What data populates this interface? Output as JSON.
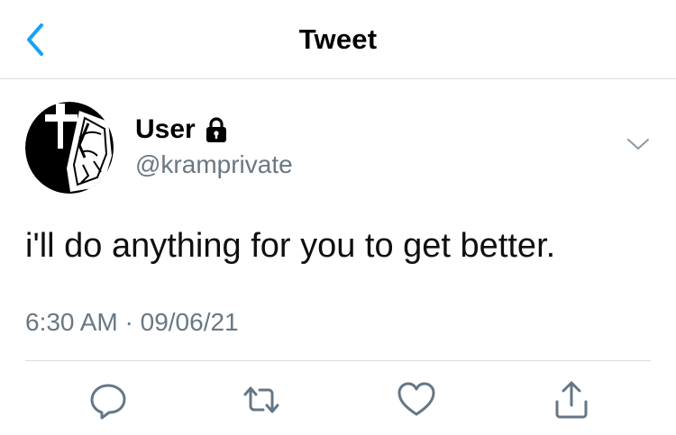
{
  "nav": {
    "title": "Tweet",
    "back_icon": "chevron-left-icon",
    "accent_color": "#1da1f2"
  },
  "tweet": {
    "author_name": "User",
    "author_handle": "@kramprivate",
    "protected_icon": "lock-icon",
    "text": "i'll do anything for you to get better.",
    "time": "6:30 AM",
    "separator": "·",
    "date": "09/06/21"
  },
  "actions": [
    {
      "name": "reply",
      "icon": "reply-icon"
    },
    {
      "name": "retweet",
      "icon": "retweet-icon"
    },
    {
      "name": "like",
      "icon": "heart-icon"
    },
    {
      "name": "share",
      "icon": "share-icon"
    }
  ],
  "colors": {
    "secondary_text": "#697882",
    "divider": "#d8dde1",
    "icon_gray": "#657786"
  }
}
